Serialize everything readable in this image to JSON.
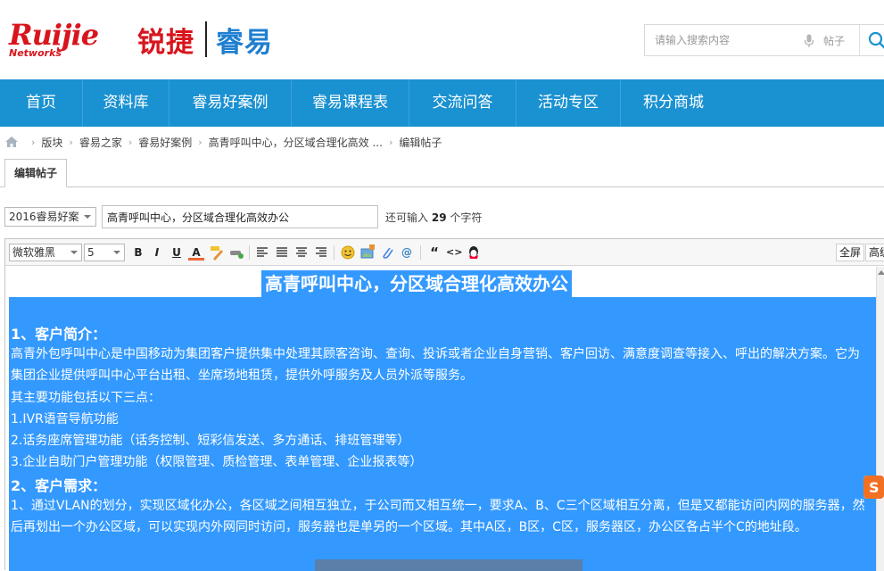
{
  "header": {
    "logo_brand": "Ruijie",
    "logo_networks": "Networks",
    "logo_cn": "锐捷",
    "logo_product": "睿易"
  },
  "search": {
    "placeholder": "请输入搜索内容",
    "type_label": "帖子"
  },
  "nav": {
    "items": [
      {
        "label": "首页"
      },
      {
        "label": "资料库"
      },
      {
        "label": "睿易好案例"
      },
      {
        "label": "睿易课程表"
      },
      {
        "label": "交流问答"
      },
      {
        "label": "活动专区"
      },
      {
        "label": "积分商城"
      }
    ]
  },
  "breadcrumb": {
    "items": [
      "版块",
      "睿易之家",
      "睿易好案例",
      "高青呼叫中心，分区域合理化高效 ...",
      "编辑帖子"
    ]
  },
  "tab": {
    "label": "编辑帖子"
  },
  "post": {
    "category": "2016睿易好案",
    "title": "高青呼叫中心，分区域合理化高效办公",
    "char_tip_prefix": "还可输入",
    "char_tip_count": "29",
    "char_tip_suffix": "个字符"
  },
  "toolbar": {
    "font_family": "微软雅黑",
    "font_size": "5",
    "bold": "B",
    "italic": "I",
    "underline": "U",
    "font_color": "A",
    "quote": "“",
    "code": "<>",
    "fullscreen": "全屏",
    "advanced": "高级"
  },
  "editor_content": {
    "title": "高青呼叫中心，分区域合理化高效办公",
    "heading1": "1、客户简介：",
    "para1": "高青外包呼叫中心是中国移动为集团客户提供集中处理其顾客咨询、查询、投诉或者企业自身营销、客户回访、满意度调查等接入、呼出的解决方案。它为集团企业提供呼叫中心平台出租、坐席场地租赁，提供外呼服务及人员外派等服务。",
    "para2": "其主要功能包括以下三点：",
    "item1": "1.IVR语音导航功能",
    "item2": "2.话务座席管理功能（话务控制、短彩信发送、多方通话、排班管理等）",
    "item3": "3.企业自助门户管理功能（权限管理、质检管理、表单管理、企业报表等）",
    "heading2": "2、客户需求：",
    "para3": "1、通过VLAN的划分，实现区域化办公，各区域之间相互独立，于公司而又相互统一，要求A、B、C三个区域相互分离，但是又都能访问内网的服务器，然后再划出一个办公区域，可以实现内外网同时访问，服务器也是单另的一个区域。其中A区，B区，C区，服务器区，办公区各占半个C的地址段。"
  },
  "colors": {
    "nav_bg": "#1a91d1",
    "brand_red": "#d8151d",
    "brand_blue": "#1f7fd0",
    "selection": "#3399ff"
  }
}
